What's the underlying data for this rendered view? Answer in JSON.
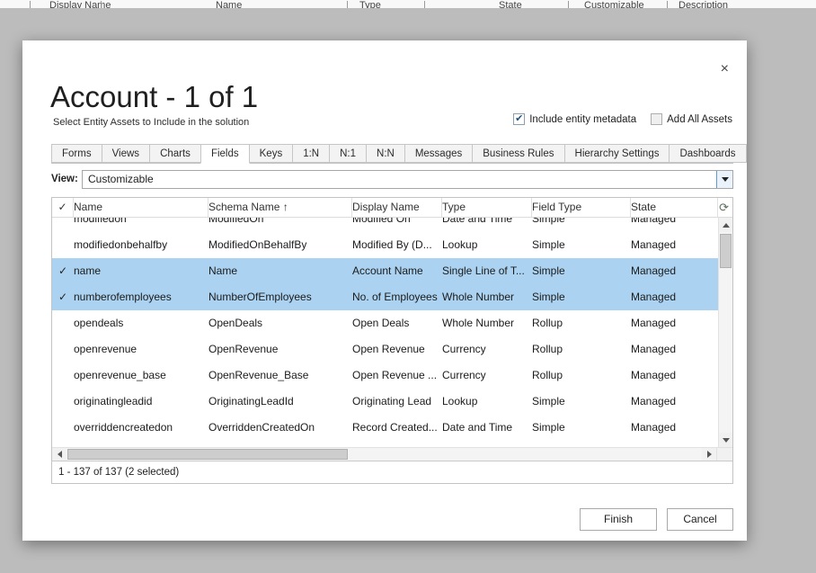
{
  "background": {
    "columns": [
      "Display Name",
      "Name",
      "Type",
      "State",
      "Customizable",
      "Description"
    ]
  },
  "dialog": {
    "title": "Account - 1 of 1",
    "subtitle": "Select Entity Assets to Include in the solution",
    "close_label": "×",
    "include_metadata_label": "Include entity metadata",
    "include_metadata_checked": true,
    "add_all_assets_label": "Add All Assets",
    "add_all_assets_checked": false,
    "check_glyph": "✓",
    "checkbox_glyph": "✔",
    "tabs": [
      "Forms",
      "Views",
      "Charts",
      "Fields",
      "Keys",
      "1:N",
      "N:1",
      "N:N",
      "Messages",
      "Business Rules",
      "Hierarchy Settings",
      "Dashboards"
    ],
    "active_tab": "Fields",
    "view_label": "View:",
    "view_value": "Customizable",
    "grid": {
      "columns": [
        "Name",
        "Schema Name",
        "Display Name",
        "Type",
        "Field Type",
        "State"
      ],
      "sort_column": "Schema Name",
      "sort_direction": "ascending",
      "sort_indicator": "↑",
      "refresh_glyph": "⟳",
      "selected_row_color": "#abd3f1",
      "rows": [
        {
          "checked": false,
          "name": "modifiedon",
          "schema_name": "ModifiedOn",
          "display_name": "Modified On",
          "type": "Date and Time",
          "field_type": "Simple",
          "state": "Managed"
        },
        {
          "checked": false,
          "name": "modifiedonbehalfby",
          "schema_name": "ModifiedOnBehalfBy",
          "display_name": "Modified By (D...",
          "type": "Lookup",
          "field_type": "Simple",
          "state": "Managed"
        },
        {
          "checked": true,
          "name": "name",
          "schema_name": "Name",
          "display_name": "Account Name",
          "type": "Single Line of T...",
          "field_type": "Simple",
          "state": "Managed"
        },
        {
          "checked": true,
          "name": "numberofemployees",
          "schema_name": "NumberOfEmployees",
          "display_name": "No. of Employees",
          "type": "Whole Number",
          "field_type": "Simple",
          "state": "Managed"
        },
        {
          "checked": false,
          "name": "opendeals",
          "schema_name": "OpenDeals",
          "display_name": "Open Deals",
          "type": "Whole Number",
          "field_type": "Rollup",
          "state": "Managed"
        },
        {
          "checked": false,
          "name": "openrevenue",
          "schema_name": "OpenRevenue",
          "display_name": "Open Revenue",
          "type": "Currency",
          "field_type": "Rollup",
          "state": "Managed"
        },
        {
          "checked": false,
          "name": "openrevenue_base",
          "schema_name": "OpenRevenue_Base",
          "display_name": "Open Revenue ...",
          "type": "Currency",
          "field_type": "Rollup",
          "state": "Managed"
        },
        {
          "checked": false,
          "name": "originatingleadid",
          "schema_name": "OriginatingLeadId",
          "display_name": "Originating Lead",
          "type": "Lookup",
          "field_type": "Simple",
          "state": "Managed"
        },
        {
          "checked": false,
          "name": "overriddencreatedon",
          "schema_name": "OverriddenCreatedOn",
          "display_name": "Record Created...",
          "type": "Date and Time",
          "field_type": "Simple",
          "state": "Managed"
        }
      ]
    },
    "status": "1 - 137 of 137 (2 selected)",
    "finish_label": "Finish",
    "cancel_label": "Cancel"
  }
}
